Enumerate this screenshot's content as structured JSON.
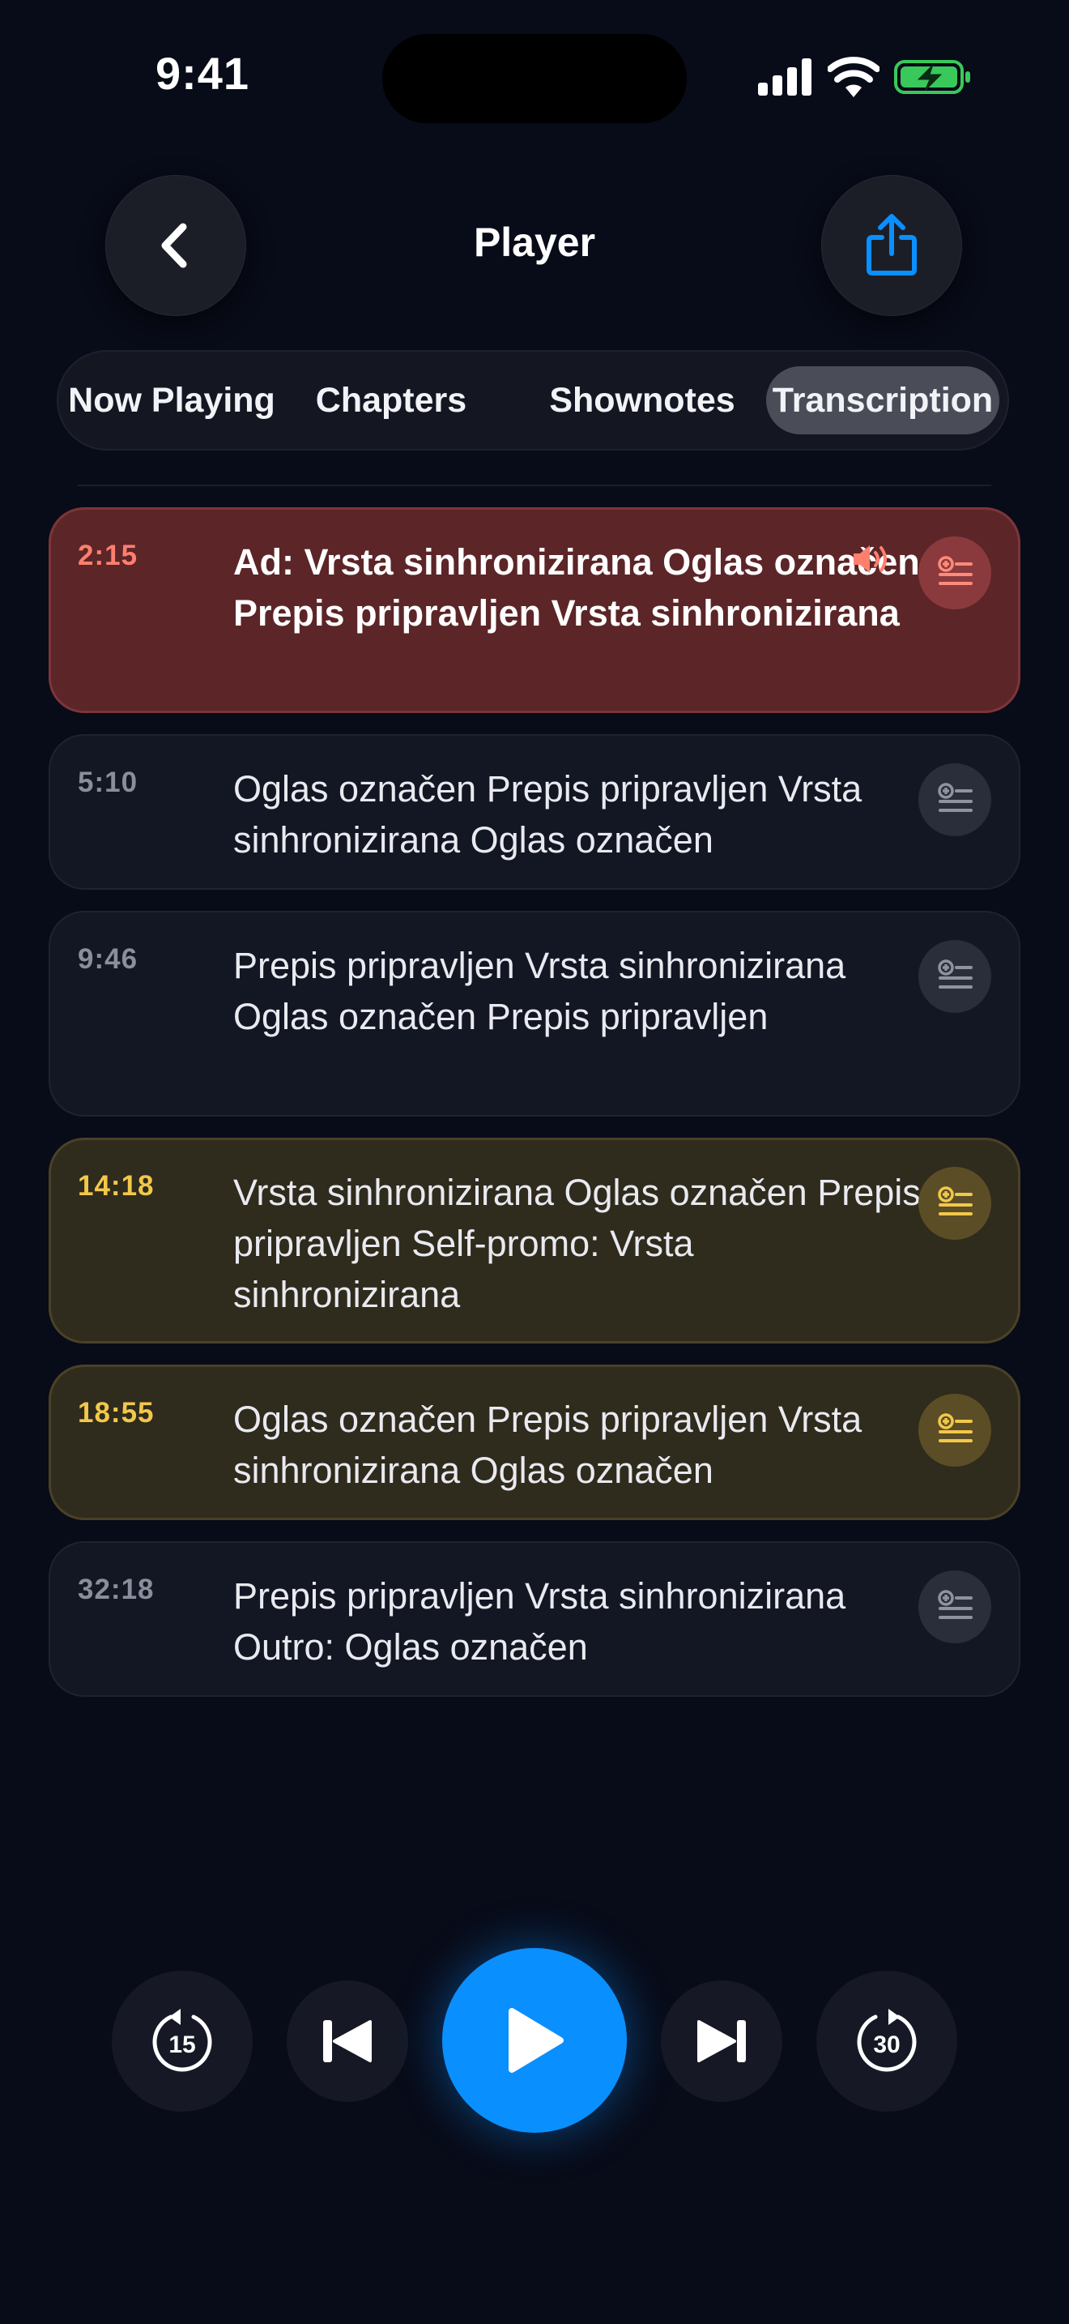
{
  "status_bar": {
    "time": "9:41"
  },
  "header": {
    "title": "Player",
    "back_icon": "chevron-left-icon",
    "share_icon": "share-icon",
    "accent_color": "#0a8fff"
  },
  "tabs": [
    {
      "label": "Now Playing",
      "active": false
    },
    {
      "label": "Chapters",
      "active": false
    },
    {
      "label": "Shownotes",
      "active": false
    },
    {
      "label": "Transcription",
      "active": true
    }
  ],
  "transcript": [
    {
      "time": "2:15",
      "text": "Ad: Vrsta sinhronizirana Oglas označen Prepis pripravljen Vrsta sinhronizirana",
      "kind": "ad",
      "playing": true,
      "color": "#ff7f6e"
    },
    {
      "time": "5:10",
      "text": "Oglas označen Prepis pripravljen Vrsta sinhronizirana Oglas označen",
      "kind": "normal"
    },
    {
      "time": "9:46",
      "text": "Prepis pripravljen Vrsta sinhronizirana Oglas označen Prepis pripravljen",
      "kind": "normal"
    },
    {
      "time": "14:18",
      "text": "Vrsta sinhronizirana Oglas označen Prepis pripravljen Self-promo: Vrsta sinhronizirana",
      "kind": "promo",
      "color": "#f2c84b"
    },
    {
      "time": "18:55",
      "text": "Oglas označen Prepis pripravljen Vrsta sinhronizirana Oglas označen",
      "kind": "promo",
      "color": "#f2c84b"
    },
    {
      "time": "32:18",
      "text": "Prepis pripravljen Vrsta sinhronizirana Outro: Oglas označen",
      "kind": "normal"
    }
  ],
  "controls": {
    "skip_back_seconds": "15",
    "skip_forward_seconds": "30",
    "icons": [
      "skip-back-15-icon",
      "previous-icon",
      "play-icon",
      "next-icon",
      "skip-forward-30-icon"
    ]
  }
}
